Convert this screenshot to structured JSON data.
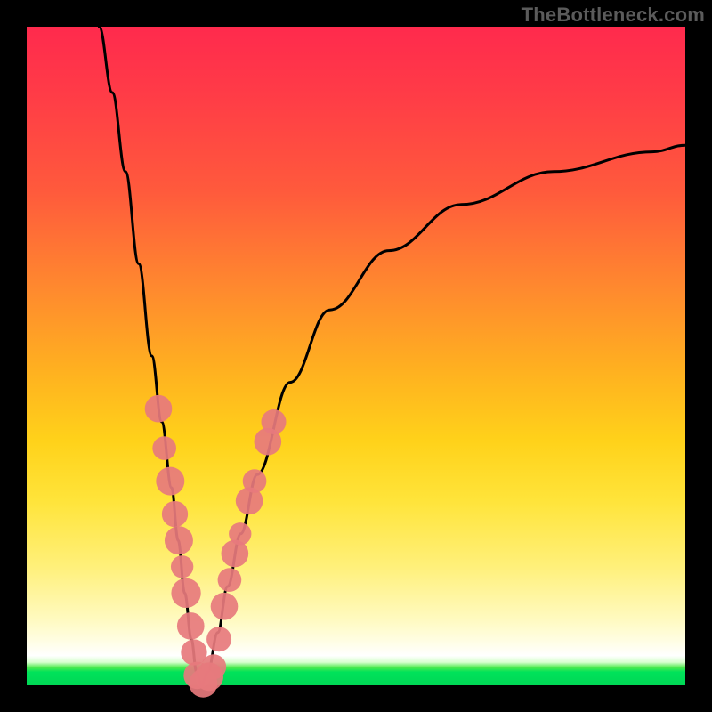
{
  "watermark_text": "TheBottleneck.com",
  "chart_data": {
    "type": "line",
    "title": "",
    "xlabel": "",
    "ylabel": "",
    "xlim": [
      0,
      100
    ],
    "ylim": [
      0,
      100
    ],
    "grid": false,
    "note": "Abstract bottleneck curve; x-axis maps horizontally, y-axis maps up. Values estimated from pixel positions.",
    "series": [
      {
        "name": "bottleneck-curve",
        "x": [
          11,
          13,
          15,
          17,
          19,
          20.5,
          22,
          23,
          24,
          25,
          25.8,
          26.5,
          27.5,
          29,
          30.5,
          32.5,
          35,
          40,
          46,
          55,
          66,
          80,
          95,
          100
        ],
        "y": [
          100,
          90,
          78,
          64,
          50,
          40,
          30,
          22,
          14,
          7,
          2,
          0,
          2,
          8,
          15,
          23,
          32,
          46,
          57,
          66,
          73,
          78,
          81,
          82
        ]
      }
    ],
    "dots": {
      "name": "highlight-dots",
      "note": "Salmon circular markers near the trough of the curve.",
      "points": [
        {
          "x": 20.0,
          "y": 42,
          "r": 1.4
        },
        {
          "x": 20.9,
          "y": 36,
          "r": 1.1
        },
        {
          "x": 21.8,
          "y": 31,
          "r": 1.5
        },
        {
          "x": 22.5,
          "y": 26,
          "r": 1.3
        },
        {
          "x": 23.1,
          "y": 22,
          "r": 1.5
        },
        {
          "x": 23.6,
          "y": 18,
          "r": 1.0
        },
        {
          "x": 24.2,
          "y": 14,
          "r": 1.6
        },
        {
          "x": 24.9,
          "y": 9,
          "r": 1.4
        },
        {
          "x": 25.4,
          "y": 5,
          "r": 1.3
        },
        {
          "x": 25.9,
          "y": 1.5,
          "r": 1.4
        },
        {
          "x": 26.8,
          "y": 0.3,
          "r": 1.5
        },
        {
          "x": 27.7,
          "y": 1.3,
          "r": 1.5
        },
        {
          "x": 28.4,
          "y": 2.8,
          "r": 1.2
        },
        {
          "x": 29.2,
          "y": 7,
          "r": 1.2
        },
        {
          "x": 30.0,
          "y": 12,
          "r": 1.4
        },
        {
          "x": 30.8,
          "y": 16,
          "r": 1.1
        },
        {
          "x": 31.6,
          "y": 20,
          "r": 1.4
        },
        {
          "x": 32.4,
          "y": 23,
          "r": 1.0
        },
        {
          "x": 33.8,
          "y": 28,
          "r": 1.4
        },
        {
          "x": 34.6,
          "y": 31,
          "r": 1.1
        },
        {
          "x": 36.6,
          "y": 37,
          "r": 1.4
        },
        {
          "x": 37.5,
          "y": 40,
          "r": 1.2
        }
      ]
    },
    "colors": {
      "curve": "#000000",
      "dots": "#e77a7d",
      "gradient_top": "#ff2a4d",
      "gradient_mid": "#ffd21a",
      "gradient_bottom": "#00d755"
    }
  }
}
